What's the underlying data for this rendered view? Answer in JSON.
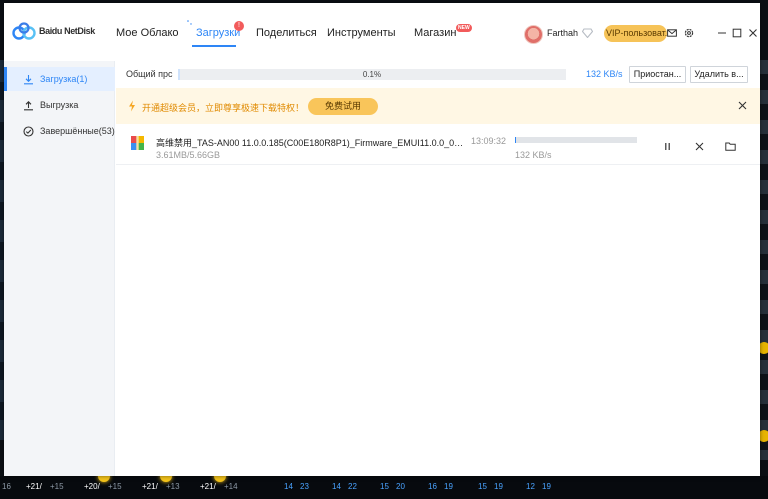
{
  "app": {
    "logo_text": "Baidu NetDisk",
    "colors": {
      "accent": "#2e86f6",
      "vip": "#f6c358",
      "badge": "#f25b5b",
      "banner_bg": "#fff7e4",
      "banner_text": "#e08a00"
    }
  },
  "nav": {
    "tabs": [
      {
        "label": "Мое Облако"
      },
      {
        "label": "Загрузки",
        "badge": "!"
      },
      {
        "label": "Поделиться"
      },
      {
        "label": "Инструменты"
      },
      {
        "label": "Магазин",
        "badge": "NEW"
      }
    ],
    "active": "Загрузки"
  },
  "user": {
    "name": "Farthah",
    "vip_label": "VIP-пользоват..."
  },
  "window_controls": {
    "icons": [
      "mail-icon",
      "settings-icon",
      "minimize-icon",
      "maximize-icon",
      "close-icon"
    ]
  },
  "sidebar": {
    "items": [
      {
        "label": "Загрузка(1)",
        "icon": "download-icon",
        "active": true
      },
      {
        "label": "Выгрузка",
        "icon": "upload-icon",
        "active": false
      },
      {
        "label": "Завершённые(53)",
        "icon": "check-circle-icon",
        "active": false
      }
    ]
  },
  "overall": {
    "label": "Общий прс",
    "percent_text": "0.1%",
    "progress": 0.001,
    "speed": "132 KB/s",
    "pause_all_label": "Приостан...",
    "delete_all_label": "Удалить в..."
  },
  "banner": {
    "text": "开通超级会员，立即尊享极速下载特权！",
    "button_label": "免费试用"
  },
  "downloads": [
    {
      "name": "高维禁用_TAS-AN00 11.0.0.185(C00E180R8P1)_Firmware_EMUI11.0.0_05016B...",
      "time": "13:09:32",
      "size": "3.61MB/5.66GB",
      "speed": "132 KB/s",
      "progress": 0.001
    }
  ],
  "background": {
    "bottom_numbers": [
      "16",
      "+21/",
      "+15",
      "+20/",
      "+15",
      "+21/",
      "+13",
      "+21/",
      "+14",
      "14",
      "23",
      "14",
      "22",
      "15",
      "20",
      "16",
      "19",
      "15",
      "19",
      "12",
      "19"
    ]
  }
}
